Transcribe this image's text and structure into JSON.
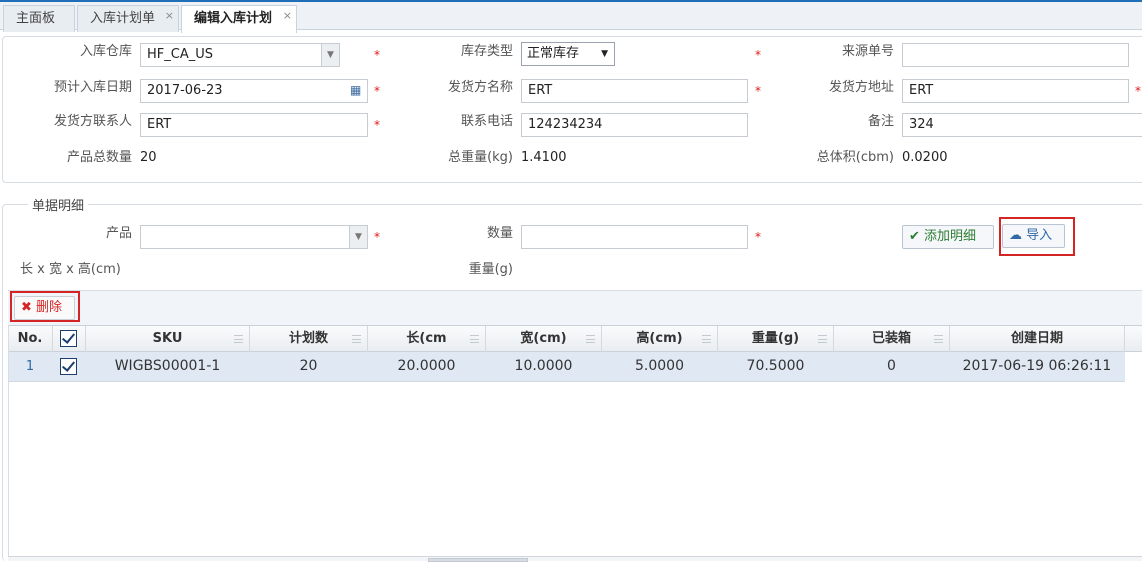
{
  "tabs": [
    {
      "label": "主面板",
      "closable": false,
      "active": false
    },
    {
      "label": "入库计划单",
      "closable": true,
      "active": false
    },
    {
      "label": "编辑入库计划",
      "closable": true,
      "active": true
    }
  ],
  "form": {
    "warehouse": {
      "label": "入库仓库",
      "value": "HF_CA_US"
    },
    "stock_type": {
      "label": "库存类型",
      "value": "正常库存"
    },
    "source_no": {
      "label": "来源单号",
      "value": ""
    },
    "plan_date": {
      "label": "预计入库日期",
      "value": "2017-06-23"
    },
    "shipper_name": {
      "label": "发货方名称",
      "value": "ERT"
    },
    "shipper_address": {
      "label": "发货方地址",
      "value": "ERT"
    },
    "shipper_contact": {
      "label": "发货方联系人",
      "value": "ERT"
    },
    "phone": {
      "label": "联系电话",
      "value": "124234234"
    },
    "remark": {
      "label": "备注",
      "value": "324"
    },
    "total_qty": {
      "label": "产品总数量",
      "value": "20"
    },
    "total_weight": {
      "label": "总重量(kg)",
      "value": "1.4100"
    },
    "total_volume": {
      "label": "总体积(cbm)",
      "value": "0.0200"
    },
    "required_mark": "*"
  },
  "detail": {
    "legend": "单据明细",
    "product_label": "产品",
    "product_value": "",
    "qty_label": "数量",
    "qty_value": "",
    "add_button": "添加明细",
    "import_button": "导入",
    "dims_label": "长 x 宽 x 高(cm)",
    "weight_label": "重量(g)",
    "delete_button": "删除"
  },
  "grid": {
    "columns": [
      "No.",
      "",
      "SKU",
      "计划数",
      "长(cm",
      "宽(cm)",
      "高(cm)",
      "重量(g)",
      "已装箱",
      "创建日期"
    ],
    "rows": [
      {
        "no": "1",
        "checked": true,
        "sku": "WIGBS00001-1",
        "plan_qty": "20",
        "length": "20.0000",
        "width": "10.0000",
        "height": "5.0000",
        "weight": "70.5000",
        "packed": "0",
        "created": "2017-06-19 06:26:11"
      }
    ],
    "header_checked": true
  },
  "colors": {
    "accent": "#1e6fb8",
    "required": "#e21a1a",
    "highlight_box": "#d52424",
    "selected_row": "#dfe8f3",
    "add_green": "#2e7d32"
  }
}
